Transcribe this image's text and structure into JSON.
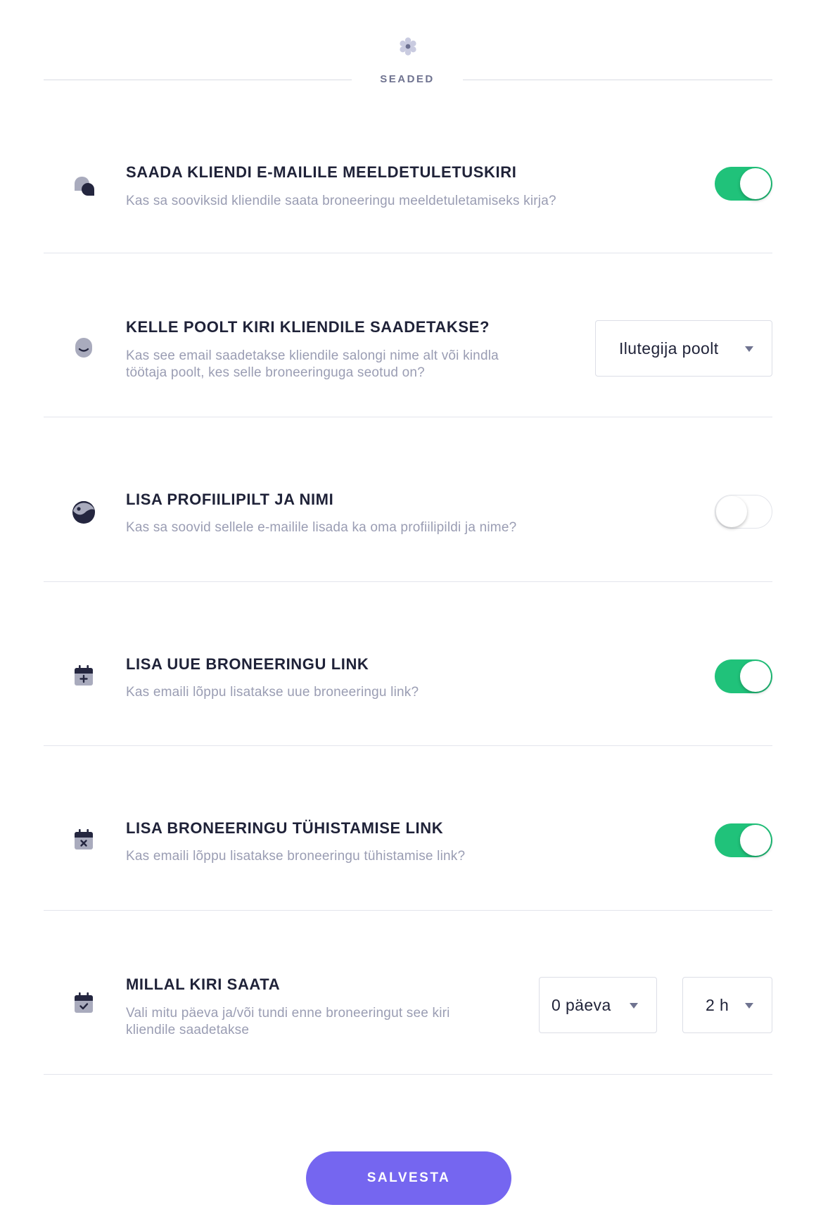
{
  "header": {
    "icon": "gear-icon",
    "title": "SEADED"
  },
  "settings": [
    {
      "icon": "chat-bubbles-icon",
      "title": "SAADA KLIENDI E-MAILILE MEELDETULETUSKIRI",
      "description": "Kas sa sooviksid kliendile saata broneeringu meeldetuletamiseks kirja?",
      "toggle_on": true
    },
    {
      "icon": "smile-face-icon",
      "title": "KELLE POOLT KIRI KLIENDILE SAADETAKSE?",
      "description_line1": "Kas see email saadetakse kliendile salongi nime alt või kindla",
      "description_line2": "töötaja poolt, kes selle broneeringuga seotud on?",
      "select_value": "Ilutegija poolt"
    },
    {
      "icon": "profile-picture-icon",
      "title": "LISA PROFIILIPILT JA NIMI",
      "description": "Kas sa soovid sellele e-mailile lisada ka oma profiilipildi ja nime?",
      "toggle_on": false
    },
    {
      "icon": "calendar-add-icon",
      "title": "LISA UUE BRONEERINGU LINK",
      "description": "Kas emaili lõppu lisatakse uue broneeringu link?",
      "toggle_on": true
    },
    {
      "icon": "calendar-cancel-icon",
      "title": "LISA BRONEERINGU TÜHISTAMISE LINK",
      "description": "Kas emaili lõppu lisatakse broneeringu tühistamise link?",
      "toggle_on": true
    },
    {
      "icon": "calendar-check-icon",
      "title": "MILLAL KIRI SAATA",
      "description_line1": "Vali mitu päeva ja/või tundi enne broneeringut see kiri",
      "description_line2": "kliendile saadetakse",
      "days_value": "0 päeva",
      "hours_value": "2 h"
    }
  ],
  "save_button": {
    "label": "SALVESTA"
  },
  "colors": {
    "toggle_on": "#20c27a",
    "primary_button": "#7566f0",
    "title_text": "#1f2238",
    "description_text": "#9a9db3",
    "icon_light": "#a9abbd",
    "icon_dark": "#24263f"
  }
}
